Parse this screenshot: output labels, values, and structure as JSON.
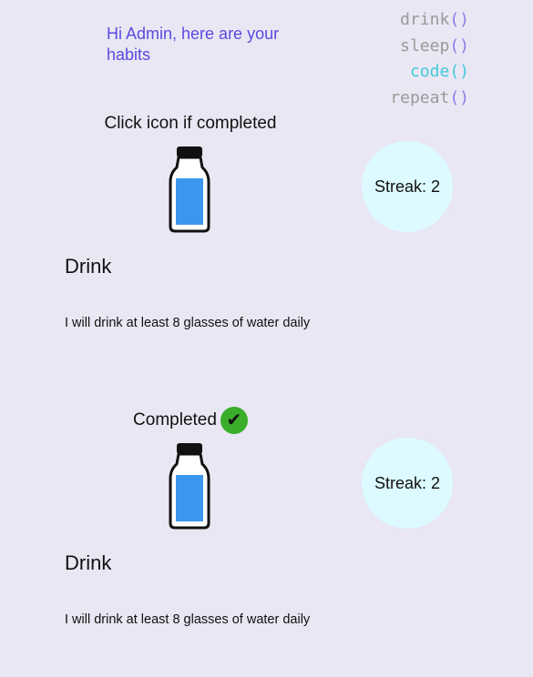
{
  "greeting": "Hi Admin, here are your habits",
  "logo_lines": [
    {
      "word": "drink",
      "parens": "()"
    },
    {
      "word": "sleep",
      "parens": "()"
    },
    {
      "word": "code",
      "parens": "()"
    },
    {
      "word": "repeat",
      "parens": "()"
    }
  ],
  "colors": {
    "background": "#e8e7f3",
    "greeting": "#5b4ae0",
    "streak_circle": "#dcfaff",
    "water": "#3a96ee",
    "check_badge": "#3aae2a"
  },
  "habits": [
    {
      "status": "Click icon if completed",
      "completed": false,
      "icon": "water-bottle-icon",
      "streak": "Streak: 2",
      "title": "Drink",
      "description": "I will drink at least 8 glasses of water daily"
    },
    {
      "status": "Completed",
      "completed": true,
      "check": "✔",
      "icon": "water-bottle-icon",
      "streak": "Streak: 2",
      "title": "Drink",
      "description": "I will drink at least 8 glasses of water daily"
    }
  ]
}
